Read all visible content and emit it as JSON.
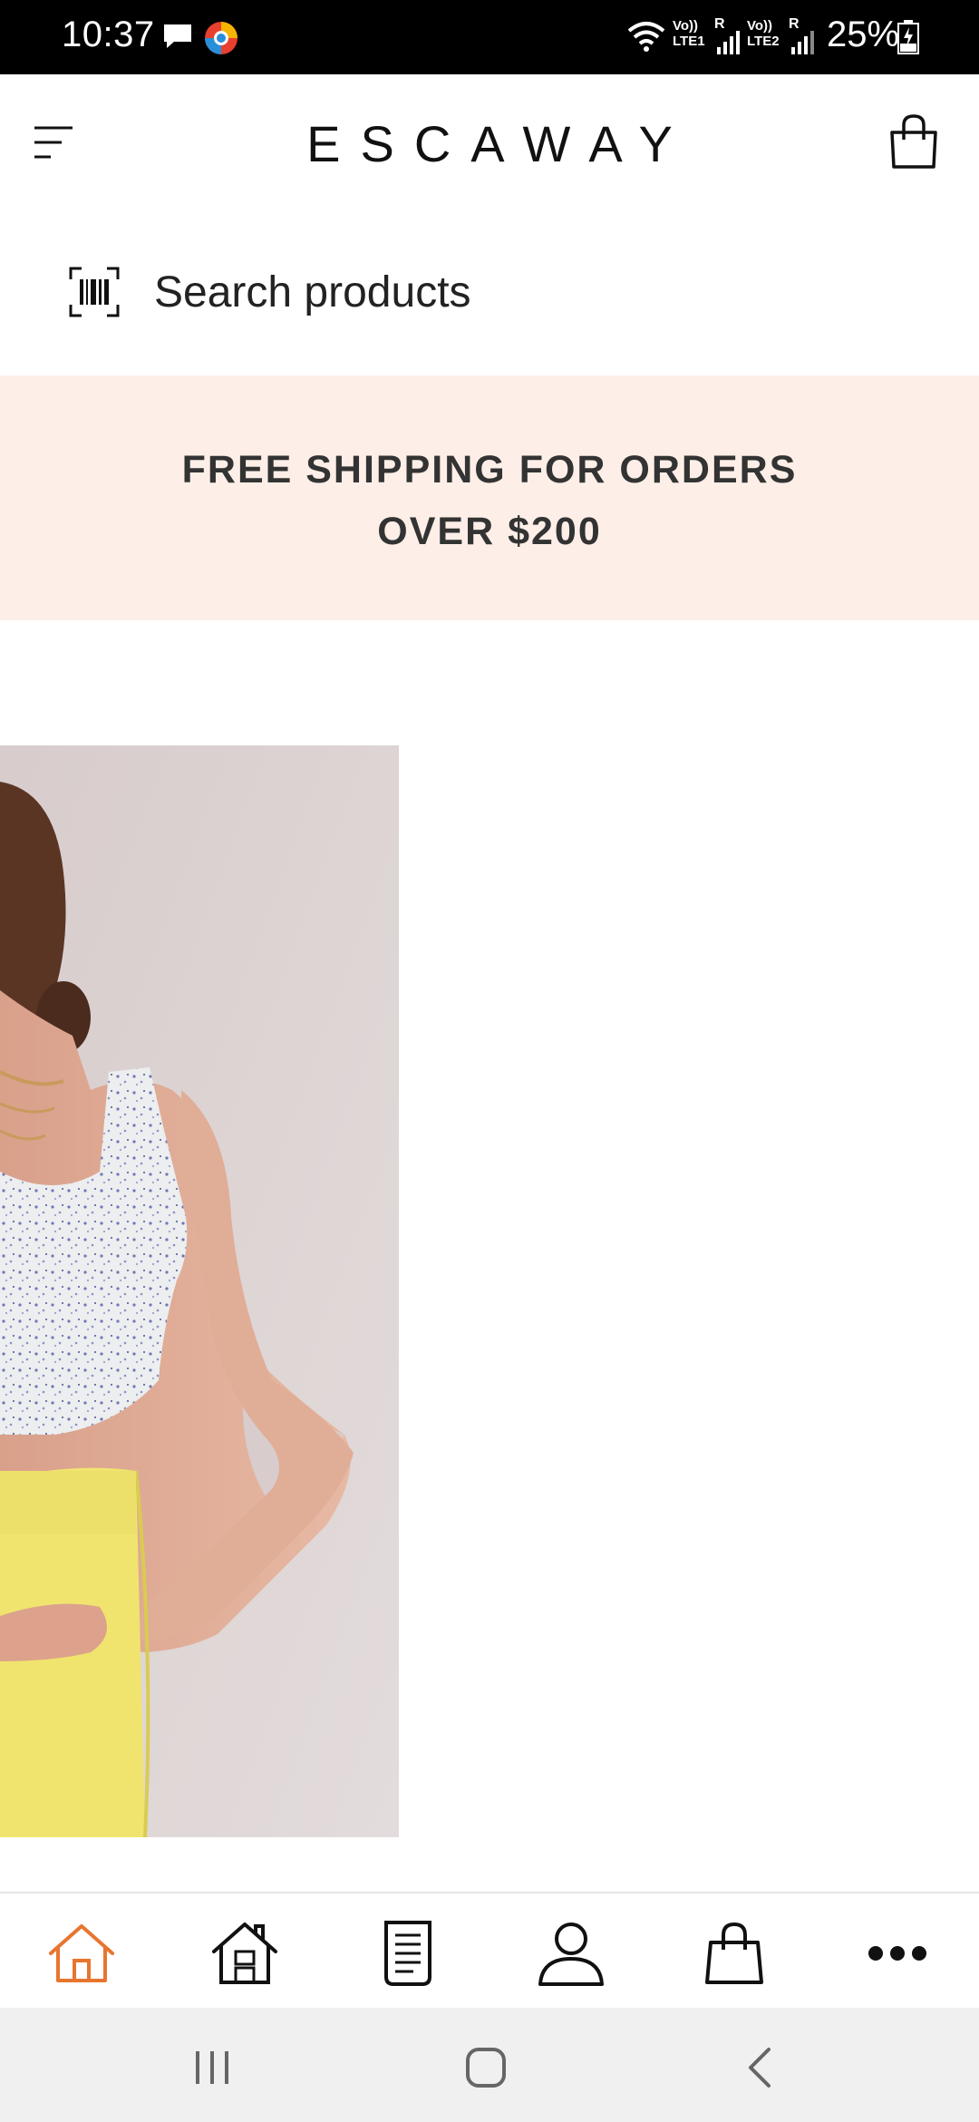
{
  "status_bar": {
    "time": "10:37",
    "sim1_tag": "Vo)) LTE1",
    "sim2_tag": "Vo)) LTE2",
    "roaming": "R",
    "battery": "25%"
  },
  "header": {
    "brand": "ESCAWAY",
    "menu_icon": "hamburger-menu-icon",
    "cart_icon": "shopping-bag-icon"
  },
  "search": {
    "placeholder": "Search products",
    "scan_icon": "barcode-scan-icon"
  },
  "banner": {
    "line1": "FREE SHIPPING FOR ORDERS",
    "line2": "OVER $200",
    "background": "#fdefe8"
  },
  "bottom_nav": {
    "accent": "#e8752f",
    "items": [
      {
        "icon": "home-outline-icon",
        "active": true
      },
      {
        "icon": "store-house-icon",
        "active": false
      },
      {
        "icon": "document-list-icon",
        "active": false
      },
      {
        "icon": "user-profile-icon",
        "active": false
      },
      {
        "icon": "shopping-bag-icon",
        "active": false
      },
      {
        "icon": "more-dots-icon",
        "active": false
      }
    ]
  },
  "system_nav": {
    "buttons": [
      "recent-apps-icon",
      "home-button-icon",
      "back-icon"
    ]
  }
}
